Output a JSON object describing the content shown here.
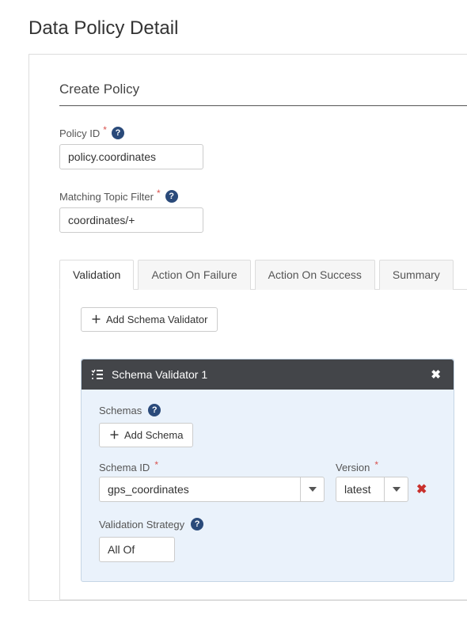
{
  "page": {
    "title": "Data Policy Detail",
    "section": "Create Policy"
  },
  "form": {
    "policy_id_label": "Policy ID",
    "policy_id_value": "policy.coordinates",
    "topic_filter_label": "Matching Topic Filter",
    "topic_filter_value": "coordinates/+"
  },
  "tabs": {
    "items": [
      {
        "label": "Validation"
      },
      {
        "label": "Action On Failure"
      },
      {
        "label": "Action On Success"
      },
      {
        "label": "Summary"
      }
    ]
  },
  "validation": {
    "add_validator_label": "Add Schema Validator"
  },
  "validator": {
    "panel_title": "Schema Validator 1",
    "schemas_label": "Schemas",
    "add_schema_label": "Add Schema",
    "schema_id_label": "Schema ID",
    "schema_id_value": "gps_coordinates",
    "version_label": "Version",
    "version_value": "latest",
    "strategy_label": "Validation Strategy",
    "strategy_value": "All Of"
  }
}
